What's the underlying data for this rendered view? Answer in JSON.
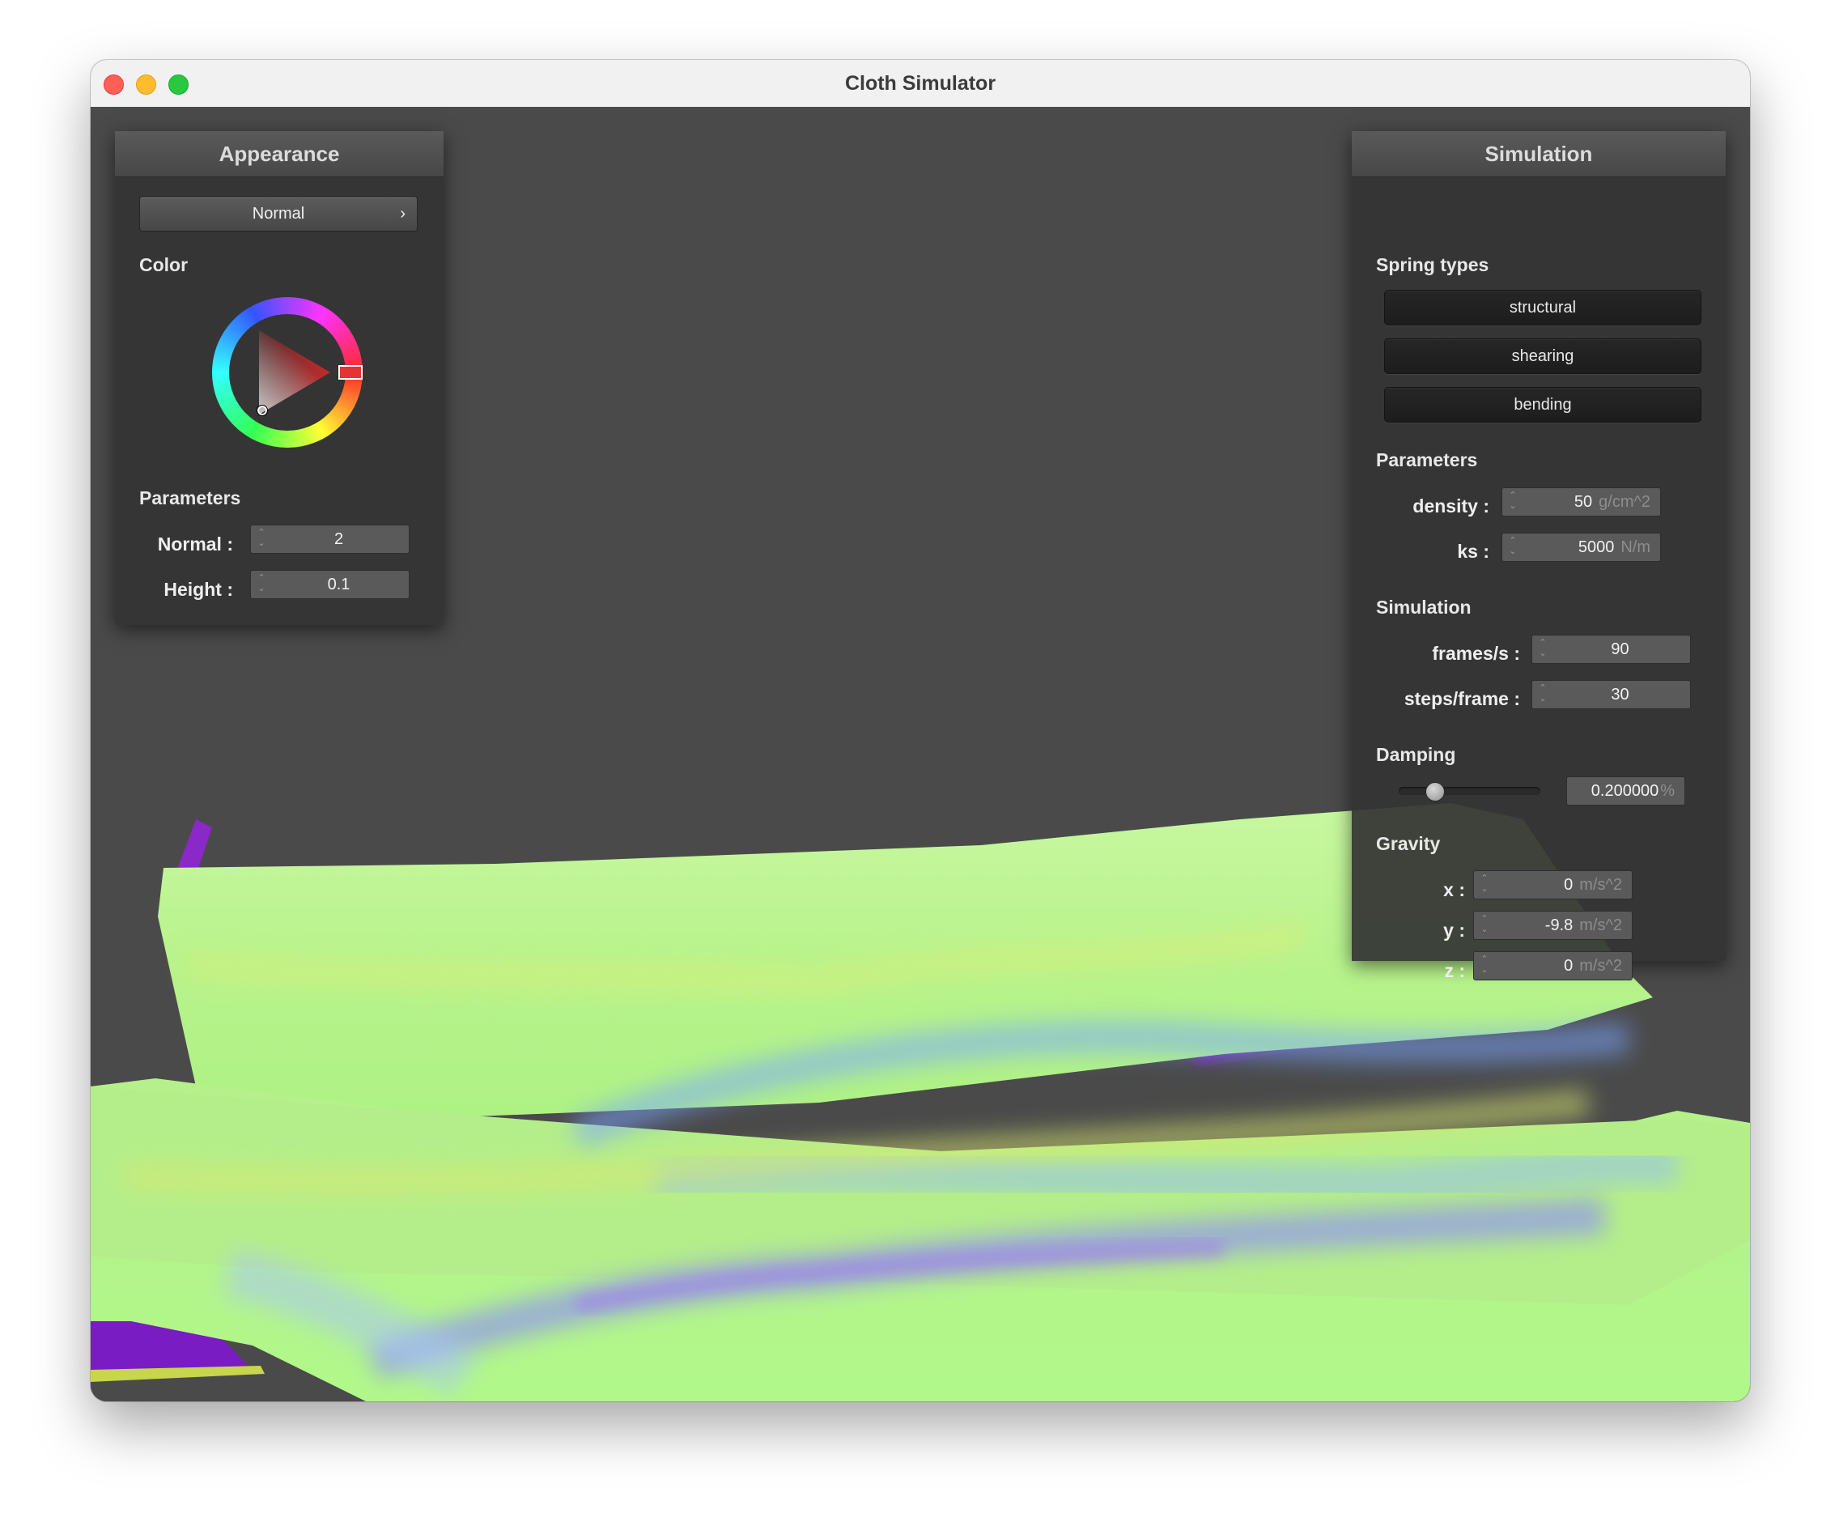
{
  "window": {
    "title": "Cloth Simulator"
  },
  "appearance": {
    "title": "Appearance",
    "shader": "Normal",
    "color_label": "Color",
    "color_hex": "#e63232",
    "parameters_label": "Parameters",
    "normal": {
      "label": "Normal :",
      "value": "2"
    },
    "height": {
      "label": "Height :",
      "value": "0.1"
    }
  },
  "simulation": {
    "title": "Simulation",
    "spring_types_label": "Spring types",
    "springs": [
      "structural",
      "shearing",
      "bending"
    ],
    "parameters_label": "Parameters",
    "density": {
      "label": "density :",
      "value": "50",
      "unit": "g/cm^2"
    },
    "ks": {
      "label": "ks :",
      "value": "5000",
      "unit": "N/m"
    },
    "simulation_label": "Simulation",
    "fps": {
      "label": "frames/s :",
      "value": "90"
    },
    "steps": {
      "label": "steps/frame :",
      "value": "30"
    },
    "damping_label": "Damping",
    "damping": {
      "value": "0.200000",
      "unit": "%",
      "fraction": 0.2
    },
    "gravity_label": "Gravity",
    "gx": {
      "label": "x :",
      "value": "0",
      "unit": "m/s^2"
    },
    "gy": {
      "label": "y :",
      "value": "-9.8",
      "unit": "m/s^2"
    },
    "gz": {
      "label": "z :",
      "value": "0",
      "unit": "m/s^2"
    }
  },
  "colors": {
    "panel_bg": "#343434",
    "viewport_bg": "#4a4a4a",
    "cloth_green": "#b2f68a",
    "cloth_blue": "#9aa8f2",
    "cloth_purple": "#8a2ad2"
  }
}
